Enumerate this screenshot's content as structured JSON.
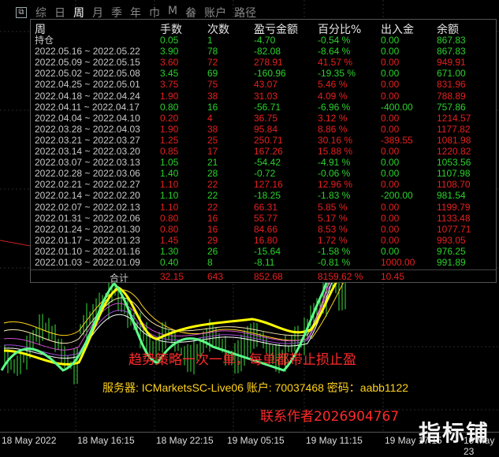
{
  "toolbar": {
    "tabs": [
      "综",
      "日",
      "周",
      "月",
      "季",
      "年",
      "巾",
      "M",
      "畚",
      "账户",
      "路径"
    ],
    "active_tab_index": 2
  },
  "stats_panel": {
    "headers": {
      "period": "周",
      "lots": "手数",
      "count": "次数",
      "pnl": "盈亏金额",
      "percent": "百分比%",
      "deposit": "出入金",
      "balance": "余额"
    },
    "rows": [
      {
        "period": "持仓",
        "lots": "0.05",
        "count": "1",
        "pnl": "-4.70",
        "percent": "-0.54 %",
        "deposit": "0.00",
        "balance": "867.83",
        "tone": "pos"
      },
      {
        "period": "2022.05.16 ~ 2022.05.22",
        "lots": "3.90",
        "count": "78",
        "pnl": "-82.08",
        "percent": "-8.64 %",
        "deposit": "0.00",
        "balance": "867.83",
        "tone": "pos"
      },
      {
        "period": "2022.05.09 ~ 2022.05.15",
        "lots": "3.60",
        "count": "72",
        "pnl": "278.91",
        "percent": "41.57 %",
        "deposit": "0.00",
        "balance": "949.91",
        "tone": "neg"
      },
      {
        "period": "2022.05.02 ~ 2022.05.08",
        "lots": "3.45",
        "count": "69",
        "pnl": "-160.96",
        "percent": "-19.35 %",
        "deposit": "0.00",
        "balance": "671.00",
        "tone": "pos"
      },
      {
        "period": "2022.04.25 ~ 2022.05.01",
        "lots": "3.75",
        "count": "75",
        "pnl": "43.07",
        "percent": "5.46 %",
        "deposit": "0.00",
        "balance": "831.96",
        "tone": "neg"
      },
      {
        "period": "2022.04.18 ~ 2022.04.24",
        "lots": "1.90",
        "count": "38",
        "pnl": "31.03",
        "percent": "4.09 %",
        "deposit": "0.00",
        "balance": "788.89",
        "tone": "neg"
      },
      {
        "period": "2022.04.11 ~ 2022.04.17",
        "lots": "0.80",
        "count": "16",
        "pnl": "-56.71",
        "percent": "-6.96 %",
        "deposit": "-400.00",
        "balance": "757.86",
        "tone": "pos"
      },
      {
        "period": "2022.04.04 ~ 2022.04.10",
        "lots": "0.20",
        "count": "4",
        "pnl": "36.75",
        "percent": "3.12 %",
        "deposit": "0.00",
        "balance": "1214.57",
        "tone": "neg"
      },
      {
        "period": "2022.03.28 ~ 2022.04.03",
        "lots": "1.90",
        "count": "38",
        "pnl": "95.84",
        "percent": "8.86 %",
        "deposit": "0.00",
        "balance": "1177.82",
        "tone": "neg"
      },
      {
        "period": "2022.03.21 ~ 2022.03.27",
        "lots": "1.25",
        "count": "25",
        "pnl": "250.71",
        "percent": "30.16 %",
        "deposit": "-389.55",
        "balance": "1081.98",
        "tone": "neg"
      },
      {
        "period": "2022.03.14 ~ 2022.03.20",
        "lots": "0.85",
        "count": "17",
        "pnl": "167.26",
        "percent": "15.88 %",
        "deposit": "0.00",
        "balance": "1220.82",
        "tone": "neg"
      },
      {
        "period": "2022.03.07 ~ 2022.03.13",
        "lots": "1.05",
        "count": "21",
        "pnl": "-54.42",
        "percent": "-4.91 %",
        "deposit": "0.00",
        "balance": "1053.56",
        "tone": "pos"
      },
      {
        "period": "2022.02.28 ~ 2022.03.06",
        "lots": "1.40",
        "count": "28",
        "pnl": "-0.72",
        "percent": "-0.06 %",
        "deposit": "0.00",
        "balance": "1107.98",
        "tone": "pos"
      },
      {
        "period": "2022.02.21 ~ 2022.02.27",
        "lots": "1.10",
        "count": "22",
        "pnl": "127.16",
        "percent": "12.96 %",
        "deposit": "0.00",
        "balance": "1108.70",
        "tone": "neg"
      },
      {
        "period": "2022.02.14 ~ 2022.02.20",
        "lots": "1.10",
        "count": "22",
        "pnl": "-18.25",
        "percent": "-1.83 %",
        "deposit": "-200.00",
        "balance": "981.54",
        "tone": "pos"
      },
      {
        "period": "2022.02.07 ~ 2022.02.13",
        "lots": "1.10",
        "count": "22",
        "pnl": "66.31",
        "percent": "5.85 %",
        "deposit": "0.00",
        "balance": "1199.79",
        "tone": "neg"
      },
      {
        "period": "2022.01.31 ~ 2022.02.06",
        "lots": "0.80",
        "count": "16",
        "pnl": "55.77",
        "percent": "5.17 %",
        "deposit": "0.00",
        "balance": "1133.48",
        "tone": "neg"
      },
      {
        "period": "2022.01.24 ~ 2022.01.30",
        "lots": "0.80",
        "count": "16",
        "pnl": "84.66",
        "percent": "8.53 %",
        "deposit": "0.00",
        "balance": "1077.71",
        "tone": "neg"
      },
      {
        "period": "2022.01.17 ~ 2022.01.23",
        "lots": "1.45",
        "count": "29",
        "pnl": "16.80",
        "percent": "1.72 %",
        "deposit": "0.00",
        "balance": "993.05",
        "tone": "neg"
      },
      {
        "period": "2022.01.10 ~ 2022.01.16",
        "lots": "1.30",
        "count": "26",
        "pnl": "-15.64",
        "percent": "-1.58 %",
        "deposit": "0.00",
        "balance": "976.25",
        "tone": "pos"
      },
      {
        "period": "2022.01.03 ~ 2022.01.09",
        "lots": "0.40",
        "count": "8",
        "pnl": "-8.11",
        "percent": "-0.81 %",
        "deposit": "1000.00",
        "balance": "991.89",
        "tone": "pos",
        "deposit_tone": "neg"
      }
    ],
    "total": {
      "label": "合计",
      "lots": "32.15",
      "count": "643",
      "pnl": "852.68",
      "percent": "8159.62 %",
      "deposit": "10.45"
    }
  },
  "overlay": {
    "strategy_text": "趋势策略一次一单，每单都带止损止盈",
    "server_text": "服务器: ICMarketsSC-Live06  账户: 70037468   密码：aabb1122",
    "contact_text": "联系作者2026904767"
  },
  "time_axis": [
    "18 May 2022",
    "18 May 16:15",
    "18 May 22:15",
    "19 May 05:15",
    "19 May 11:15",
    "19 May 17:15",
    "19 May 23"
  ],
  "watermark": "指标铺",
  "colors": {
    "profit_green": "#2bd12b",
    "loss_red": "#e52020",
    "overlay_red": "#ff2a2a",
    "overlay_yellow": "#ffd21a"
  }
}
